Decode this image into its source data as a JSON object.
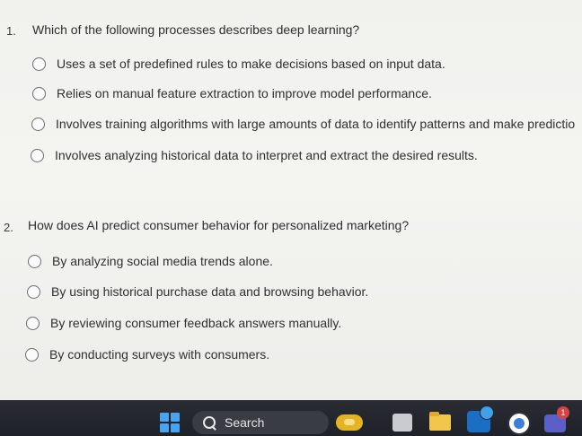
{
  "questions": [
    {
      "number": "1.",
      "text": "Which of the following processes describes deep learning?",
      "options": [
        "Uses a set of predefined rules to make decisions based on input data.",
        "Relies on manual feature extraction to improve model performance.",
        "Involves training algorithms with large amounts of data to identify patterns and make predictio",
        "Involves analyzing historical data to interpret and extract the desired results."
      ]
    },
    {
      "number": "2.",
      "text": "How does AI predict consumer behavior for personalized marketing?",
      "options": [
        "By analyzing social media trends alone.",
        "By using historical purchase data and browsing behavior.",
        "By reviewing consumer feedback answers manually.",
        "By conducting surveys with consumers."
      ]
    }
  ],
  "taskbar": {
    "search_label": "Search",
    "teams_badge": "1",
    "icons": [
      "windows-start-icon",
      "search-icon",
      "weather-icon",
      "app-icon",
      "file-explorer-icon",
      "outlook-icon",
      "edge-icon",
      "teams-icon"
    ],
    "colors": {
      "background": "#24262d",
      "start_accent": "#4aa3ef",
      "badge": "#d64545"
    }
  }
}
